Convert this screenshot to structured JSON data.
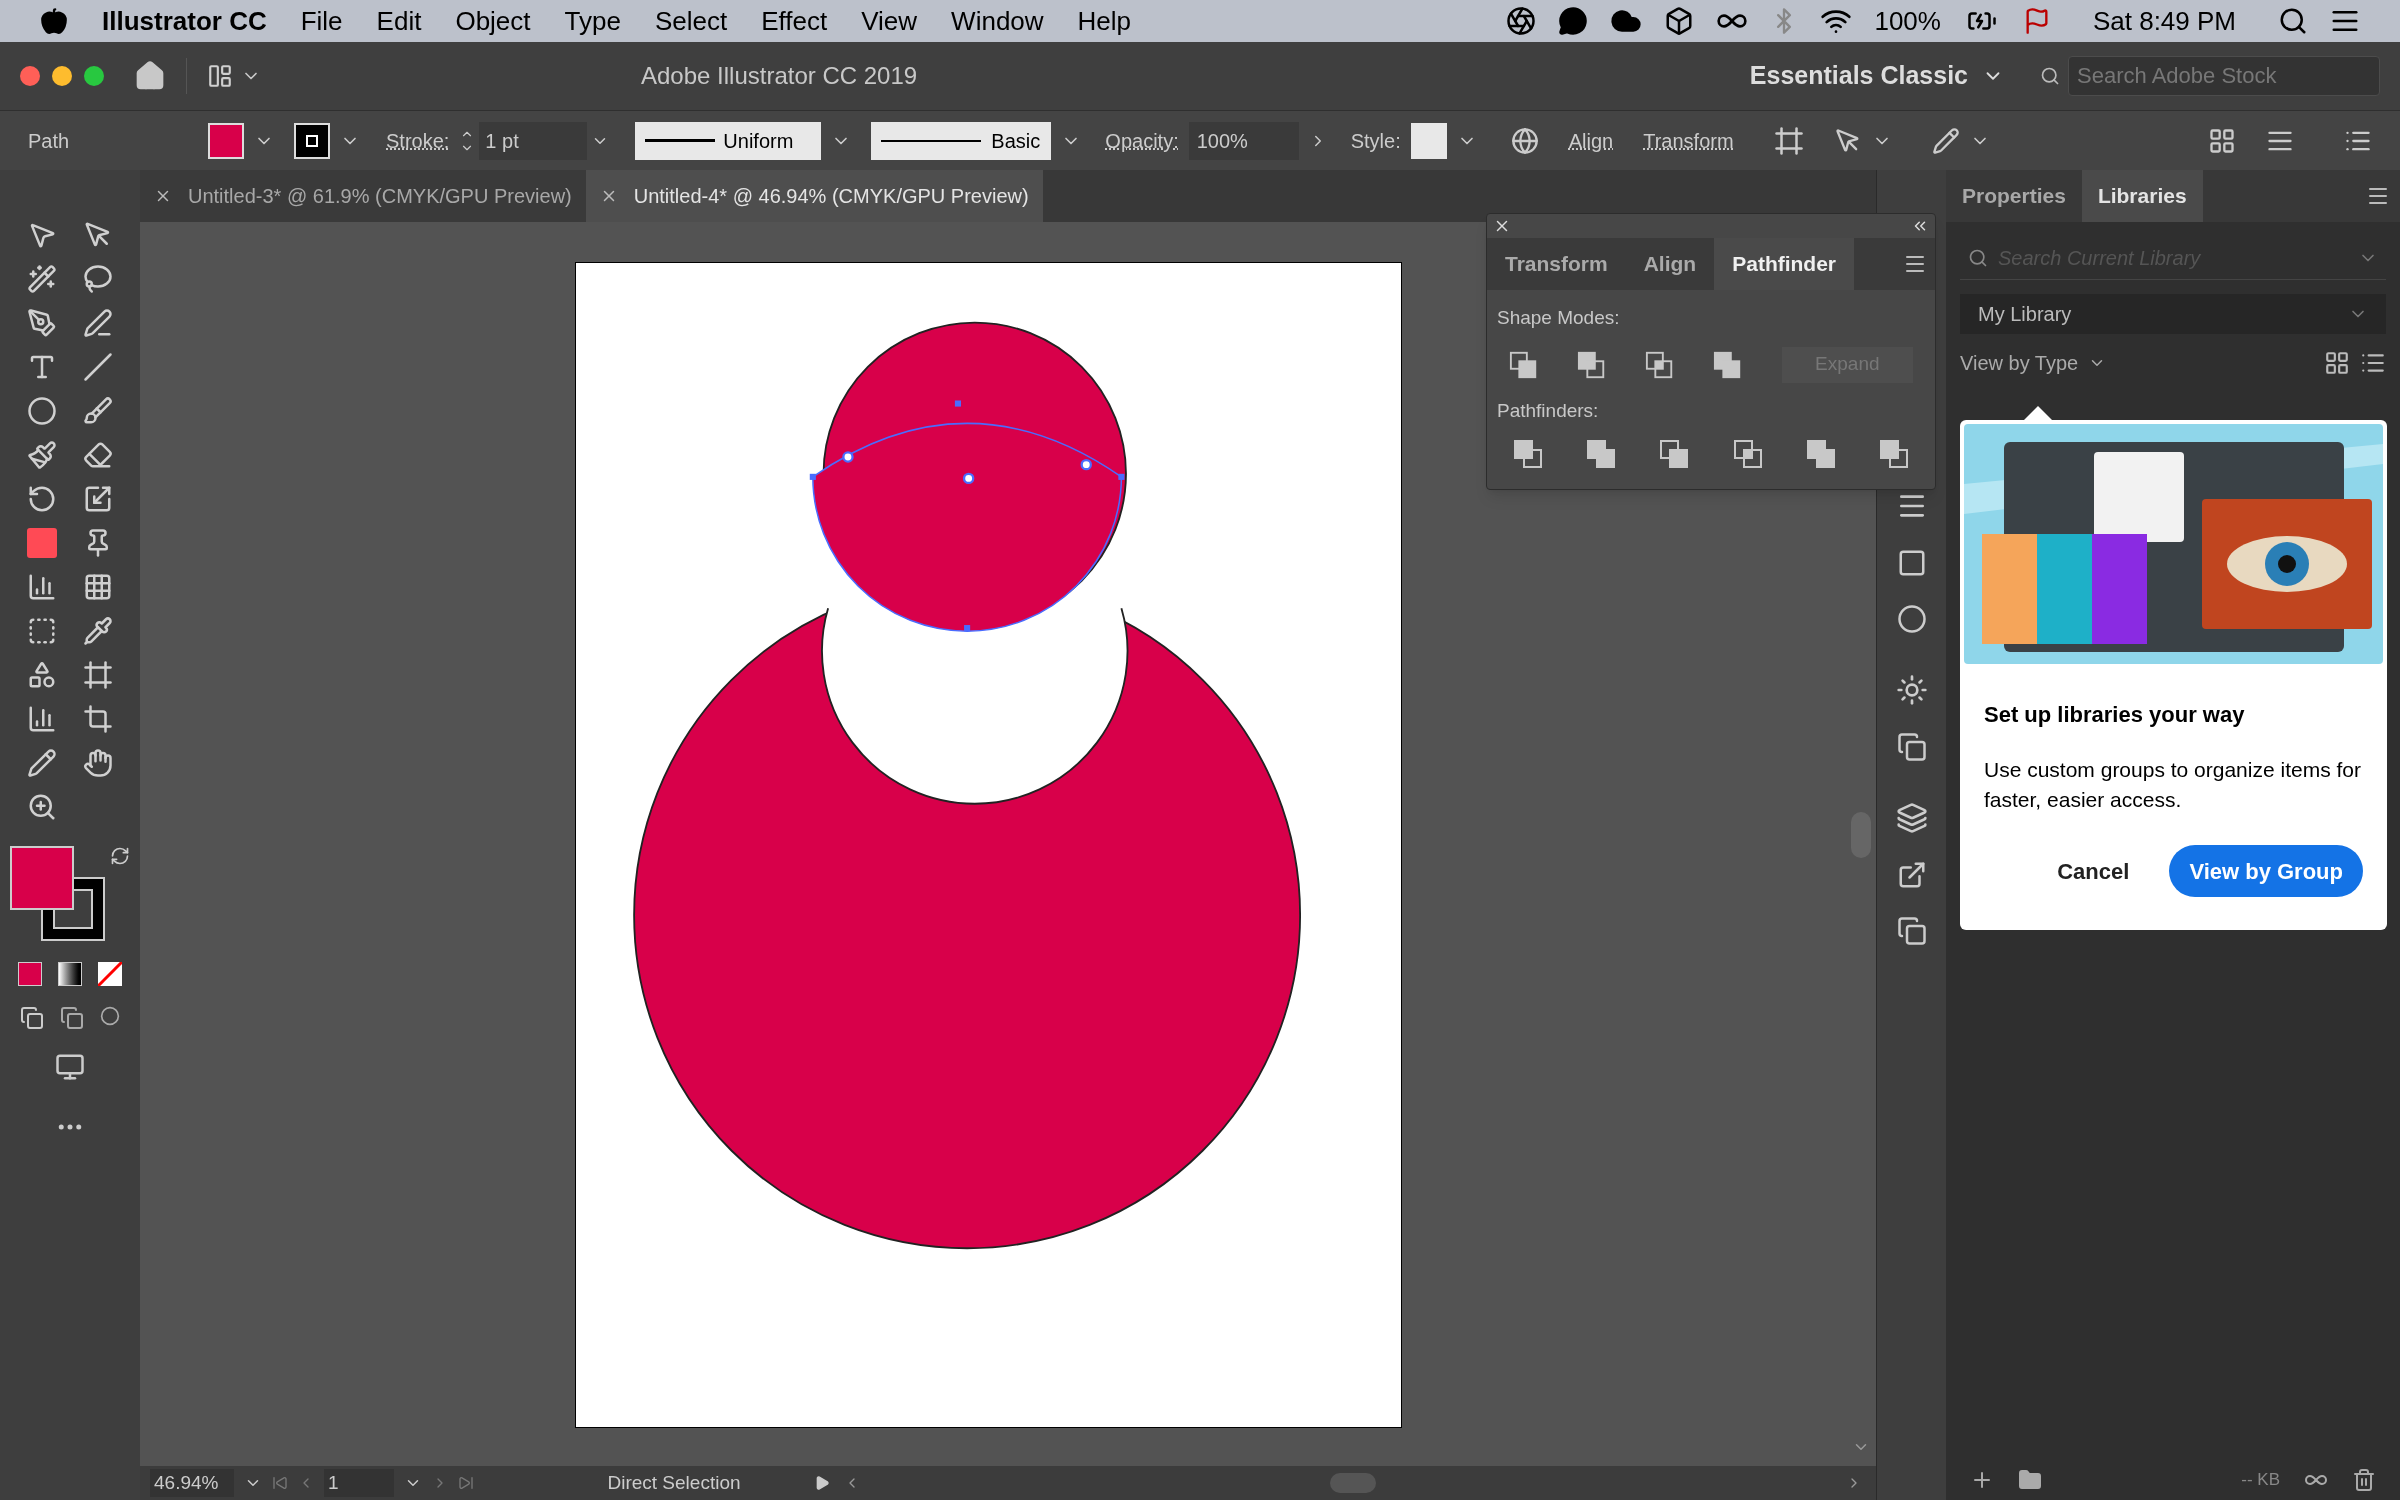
{
  "menu_bar": {
    "app": "Illustrator CC",
    "items": [
      "File",
      "Edit",
      "Object",
      "Type",
      "Select",
      "Effect",
      "View",
      "Window",
      "Help"
    ],
    "battery": "100%",
    "clock": "Sat 8:49 PM"
  },
  "title_bar": {
    "title": "Adobe Illustrator CC 2019",
    "workspace": "Essentials Classic",
    "search": {
      "placeholder": "Search Adobe Stock"
    }
  },
  "control_bar": {
    "selection": "Path",
    "stroke_label": "Stroke:",
    "stroke_weight": "1 pt",
    "profile": "Uniform",
    "brush": "Basic",
    "opacity_label": "Opacity:",
    "opacity": "100%",
    "style_label": "Style:",
    "links": [
      "Align",
      "Transform"
    ]
  },
  "document_tabs": [
    {
      "title": "Untitled-3* @ 61.9% (CMYK/GPU Preview)",
      "selected": false
    },
    {
      "title": "Untitled-4* @ 46.94% (CMYK/GPU Preview)",
      "selected": true
    }
  ],
  "pathfinder_panel": {
    "tabs": [
      {
        "label": "Transform",
        "selected": false
      },
      {
        "label": "Align",
        "selected": false
      },
      {
        "label": "Pathfinder",
        "selected": true
      }
    ],
    "shape_modes_label": "Shape Modes:",
    "expand_button": {
      "label": "Expand",
      "disabled": true
    },
    "pathfinders_label": "Pathfinders:"
  },
  "right_panel": {
    "tabs": [
      {
        "label": "Properties",
        "selected": false
      },
      {
        "label": "Libraries",
        "selected": true
      }
    ],
    "search": {
      "placeholder": "Search Current Library"
    },
    "library": "My Library",
    "view": "View by Type",
    "popup": {
      "heading": "Set up libraries your way",
      "body": "Use custom groups to organize items for faster, easier access.",
      "cancel": "Cancel",
      "confirm": "View by Group"
    },
    "storage": "-- KB"
  },
  "status_bar": {
    "zoom": "46.94%",
    "artboard": "1",
    "tool": "Direct Selection"
  }
}
